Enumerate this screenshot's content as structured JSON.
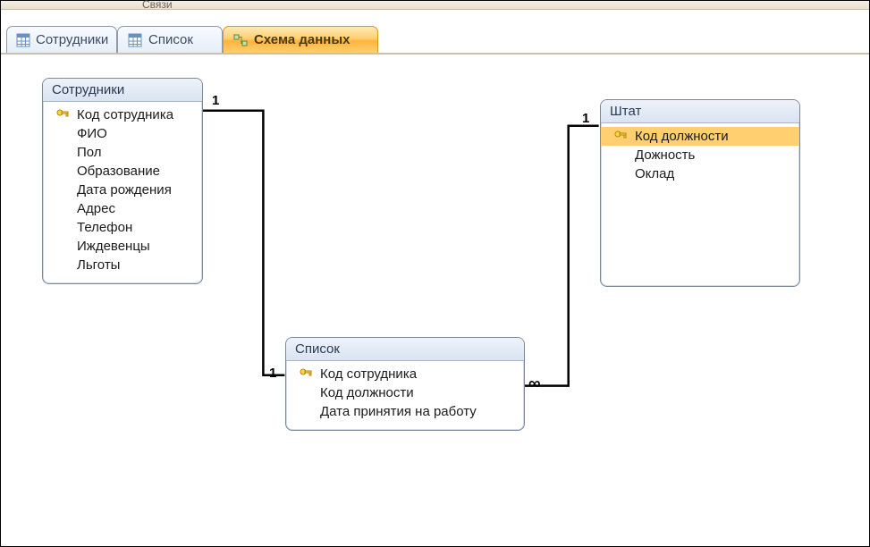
{
  "ribbon_group_hint": "Связи",
  "tabs": [
    {
      "label": "Сотрудники"
    },
    {
      "label": "Список"
    },
    {
      "label": "Схема данных"
    }
  ],
  "tables": {
    "employees": {
      "title": "Сотрудники",
      "fields": [
        {
          "label": "Код сотрудника",
          "pk": true
        },
        {
          "label": "ФИО"
        },
        {
          "label": "Пол"
        },
        {
          "label": "Образование"
        },
        {
          "label": "Дата рождения"
        },
        {
          "label": "Адрес"
        },
        {
          "label": "Телефон"
        },
        {
          "label": "Иждевенцы"
        },
        {
          "label": "Льготы"
        }
      ]
    },
    "list": {
      "title": "Список",
      "fields": [
        {
          "label": "Код сотрудника",
          "pk": true
        },
        {
          "label": "Код должности"
        },
        {
          "label": "Дата принятия на работу"
        }
      ]
    },
    "staff": {
      "title": "Штат",
      "fields": [
        {
          "label": "Код должности",
          "pk": true,
          "selected": true
        },
        {
          "label": "Дожность"
        },
        {
          "label": "Оклад"
        }
      ]
    }
  },
  "relationships": {
    "emp_to_list": {
      "left_card": "1",
      "right_card": "1"
    },
    "list_to_staff": {
      "left_card": "∞",
      "right_card": "1"
    }
  },
  "colors": {
    "tab_active": "#ffcf70",
    "box_border": "#7a8799",
    "header_bg": "#d9e3f1"
  }
}
